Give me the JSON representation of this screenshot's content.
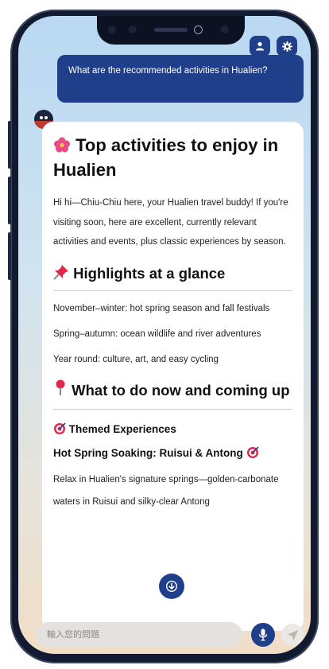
{
  "chat": {
    "user_message": "What are the recommended activities in Hualien?"
  },
  "answer": {
    "title_icon": "hibiscus-icon",
    "title": "Top activities to enjoy in Hualien",
    "intro": "Hi hi—Chiu-Chiu here, your Hualien travel buddy! If you're visiting soon, here are excellent, currently relevant activities and events, plus classic experiences by season.",
    "highlights_icon": "pushpin-icon",
    "highlights_heading": "Highlights at a glance",
    "highlights": [
      "November–winter: hot spring season and fall festivals",
      "Spring–autumn: ocean wildlife and river adventures",
      "Year round: culture, art, and easy cycling"
    ],
    "now_icon": "round-pushpin-icon",
    "now_heading": "What to do now and coming up",
    "themed_icon": "target-icon",
    "themed_heading": "Themed Experiences",
    "spring_heading": "Hot Spring Soaking: Ruisui & Antong",
    "spring_text": "Relax in Hualien's signature springs—golden-carbonate waters in Ruisui and silky-clear Antong"
  },
  "input": {
    "placeholder": "輸入您的問題"
  },
  "colors": {
    "accent": "#1f3f8a",
    "phone_frame": "#111a2e"
  }
}
